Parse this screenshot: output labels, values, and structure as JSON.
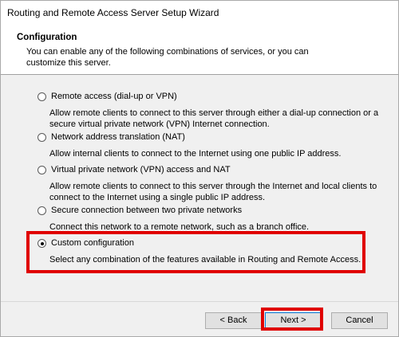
{
  "window": {
    "title": "Routing and Remote Access Server Setup Wizard"
  },
  "header": {
    "title": "Configuration",
    "subtitle": "You can enable any of the following combinations of services, or you can customize this server."
  },
  "options": [
    {
      "label": "Remote access (dial-up or VPN)",
      "description": "Allow remote clients to connect to this server through either a dial-up connection or a secure virtual private network (VPN) Internet connection.",
      "selected": false
    },
    {
      "label": "Network address translation (NAT)",
      "description": "Allow internal clients to connect to the Internet using one public IP address.",
      "selected": false
    },
    {
      "label": "Virtual private network (VPN) access and NAT",
      "description": "Allow remote clients to connect to this server through the Internet and local clients to connect to the Internet using a single public IP address.",
      "selected": false
    },
    {
      "label": "Secure connection between two private networks",
      "description": "Connect this network to a remote network, such as a branch office.",
      "selected": false
    },
    {
      "label": "Custom configuration",
      "description": "Select any combination of the features available in Routing and Remote Access.",
      "selected": true
    }
  ],
  "buttons": {
    "back": "< Back",
    "next": "Next >",
    "cancel": "Cancel"
  },
  "colors": {
    "highlight": "#e00000",
    "content_bg": "#f0f0f0",
    "focus_border": "#0078d7"
  }
}
